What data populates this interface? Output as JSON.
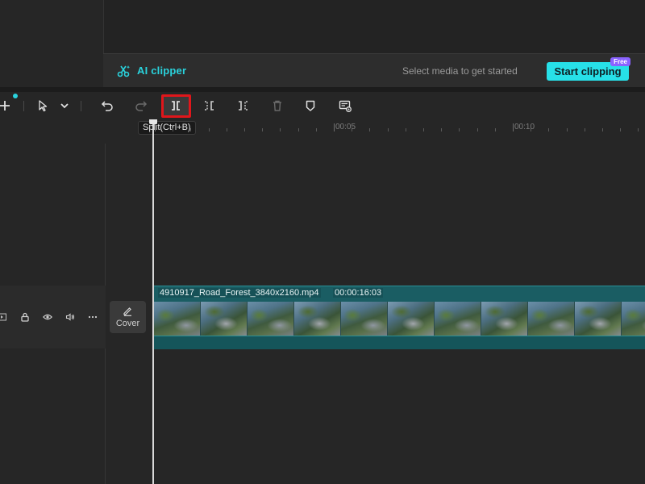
{
  "ai_clipper": {
    "title": "AI clipper",
    "hint": "Select media to get started",
    "button_label": "Start clipping",
    "badge": "Free",
    "icon": "scissors-sparkle-icon",
    "accent": "#2ad3dd"
  },
  "toolbar": {
    "items": [
      {
        "name": "add",
        "icon": "plus-icon"
      },
      {
        "name": "select",
        "icon": "pointer-icon"
      },
      {
        "name": "select-dropdown",
        "icon": "chevron-down-icon"
      },
      {
        "name": "undo",
        "icon": "undo-icon"
      },
      {
        "name": "redo",
        "icon": "redo-icon"
      },
      {
        "name": "split",
        "icon": "split-icon"
      },
      {
        "name": "split-left",
        "icon": "split-left-icon"
      },
      {
        "name": "split-right",
        "icon": "split-right-icon"
      },
      {
        "name": "delete",
        "icon": "trash-icon"
      },
      {
        "name": "marker",
        "icon": "marker-icon"
      },
      {
        "name": "screen-recorder",
        "icon": "record-icon"
      }
    ],
    "tooltip": "Split(Ctrl+B)",
    "highlight_color": "#e0161b"
  },
  "ruler": {
    "labels": [
      "00:05",
      "00:10"
    ]
  },
  "track": {
    "icons": [
      "video-track-icon",
      "lock-icon",
      "eye-icon",
      "volume-icon",
      "more-icon"
    ],
    "cover_label": "Cover"
  },
  "clip": {
    "filename": "4910917_Road_Forest_3840x2160.mp4",
    "duration": "00:00:16:03",
    "color": "#1a5d63"
  }
}
